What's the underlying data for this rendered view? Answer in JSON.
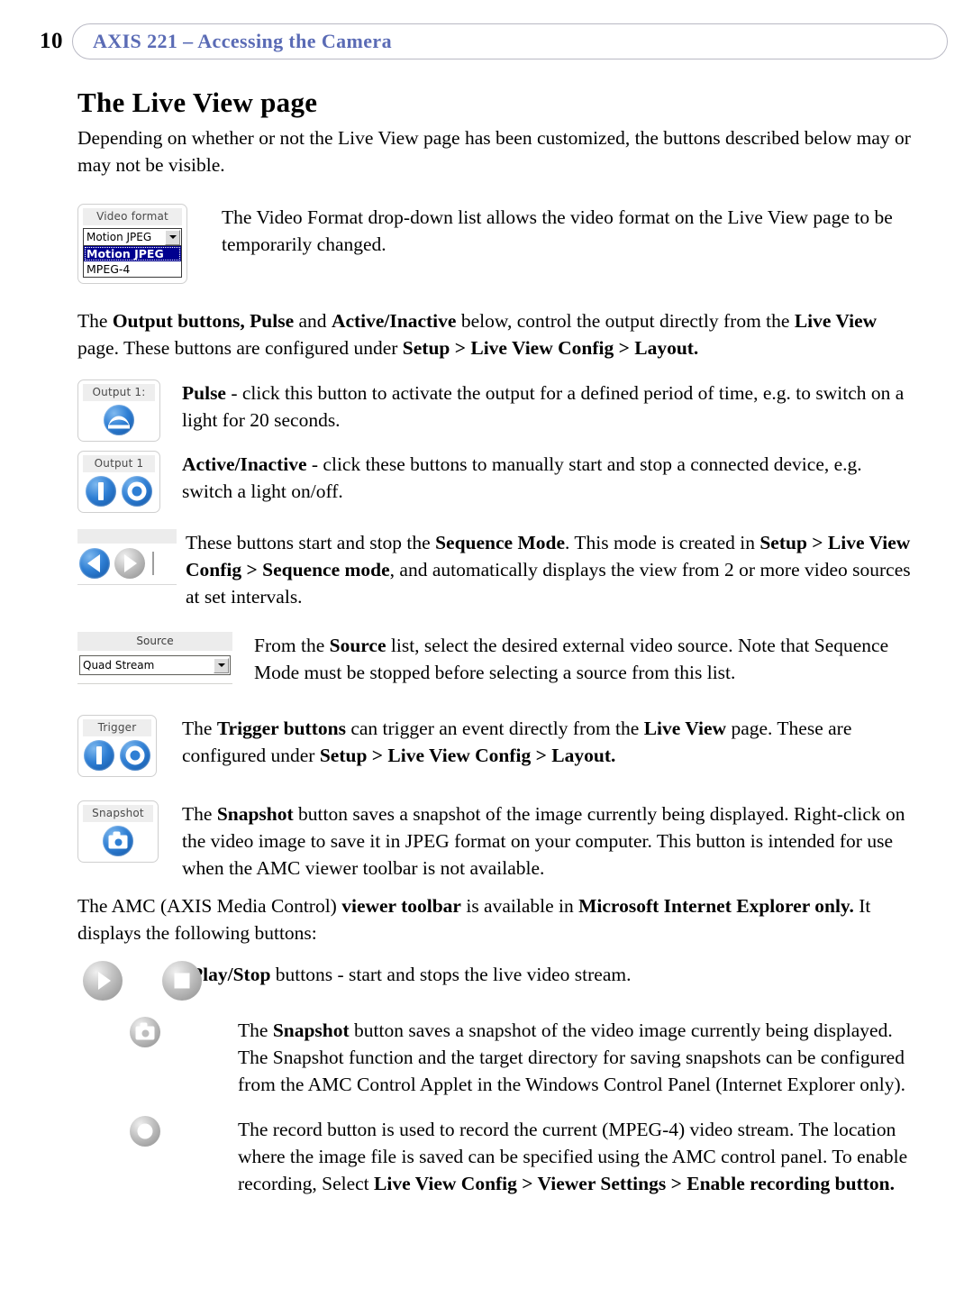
{
  "header": {
    "page_number": "10",
    "title": "AXIS 221 – Accessing the Camera",
    "accent_color": "#5a6bb5"
  },
  "section": {
    "title": "The Live View page",
    "intro": "Depending on whether or not the Live View page has been customized, the buttons described below may or may not be visible."
  },
  "widgets": {
    "video_format": {
      "label": "Video format",
      "value": "Motion JPEG",
      "options": [
        "Motion JPEG",
        "MPEG-4"
      ],
      "selected_option": "Motion JPEG",
      "highlight_color": "#00008f"
    },
    "output_pulse": {
      "label": "Output 1:",
      "icon": "pulse-icon"
    },
    "output_active_inactive": {
      "label": "Output 1",
      "icons": [
        "active-bar-icon",
        "inactive-ring-icon"
      ]
    },
    "sequence": {
      "icons": [
        "sequence-start-icon",
        "sequence-stop-icon"
      ]
    },
    "source": {
      "label": "Source",
      "value": "Quad Stream"
    },
    "trigger": {
      "label": "Trigger",
      "icons": [
        "trigger-active-icon",
        "trigger-inactive-icon"
      ]
    },
    "snapshot": {
      "label": "Snapshot",
      "icon": "camera-icon"
    },
    "amc_play_stop": {
      "icons": [
        "play-icon",
        "stop-icon"
      ]
    },
    "amc_snapshot": {
      "icon": "camera-icon"
    },
    "amc_record": {
      "icon": "record-icon"
    }
  },
  "paragraphs": {
    "video_format_desc": {
      "a": "The Video Format drop-down list allows the video format on the Live View page to be temporarily changed."
    },
    "output_intro": {
      "a": "The ",
      "b1": "Output buttons, Pulse",
      "b_mid": " and ",
      "b2": "Active/Inactive",
      "c": " below, control the output directly from the ",
      "b3": "Live View",
      "d": " page. These buttons are configured under ",
      "b4": "Setup > Live View Config > Layout.",
      "e": ""
    },
    "pulse": {
      "b": "Pulse",
      "a": " - click this button to activate the output for a defined period of time, e.g. to switch on a light for 20 seconds."
    },
    "active_inactive": {
      "b": "Active/Inactive",
      "a": " - click these buttons to manually start and stop a connected device, e.g. switch a light on/off."
    },
    "sequence": {
      "a": "These buttons start and stop the ",
      "b1": "Sequence Mode",
      "c": ". This mode is created in ",
      "b2": "Setup > Live View Config > Sequence mode",
      "d": ", and automatically displays the view from 2 or more video sources at set intervals."
    },
    "source": {
      "a": "From the ",
      "b1": "Source",
      "c": " list, select the desired external video source. Note that Sequence Mode must be stopped before selecting a source from this list."
    },
    "trigger": {
      "a": "The ",
      "b1": "Trigger buttons",
      "c": " can trigger an event directly from the ",
      "b2": "Live View",
      "d": " page. These are configured under ",
      "b3": "Setup > Live View Config > Layout.",
      "e": ""
    },
    "snapshot": {
      "a": "The ",
      "b1": "Snapshot",
      "c": " button saves a snapshot of the image currently being displayed. Right-click on the video image to save it in JPEG format on your computer. This button is intended for use when the AMC viewer toolbar is not available."
    },
    "amc_intro": {
      "a": "The AMC (AXIS Media Control) ",
      "b1": "viewer toolbar",
      "c": " is available in ",
      "b2": "Microsoft Internet Explorer only.",
      "d": " It displays the following buttons:"
    },
    "play_stop": {
      "b1": "Play/Stop",
      "a": " buttons - start and stops the live video stream."
    },
    "amc_snapshot": {
      "a": "The ",
      "b1": "Snapshot",
      "c": " button saves a snapshot of the video image currently being displayed. The Snapshot function and the target directory for saving snapshots can be configured from the AMC Control Applet in the Windows Control Panel (Internet Explorer only)."
    },
    "amc_record": {
      "a": "The record button is used to record the current (MPEG-4) video stream. The location where the image file is saved can be specified using the AMC control panel. To enable recording, Select ",
      "b1": "Live View Config > Viewer Settings > Enable recording button.",
      "c": ""
    }
  }
}
